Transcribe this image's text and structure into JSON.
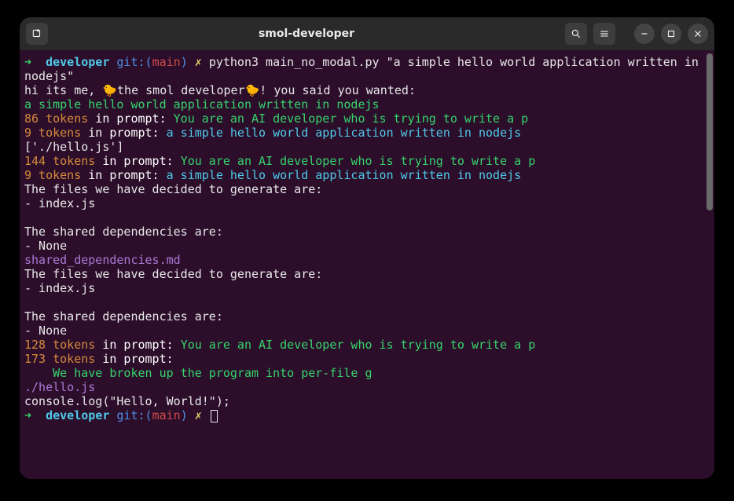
{
  "title": "smol-developer",
  "prompt": {
    "arrow": "➜",
    "dir": "developer",
    "git": "git:(",
    "branch": "main",
    "gitclose": ")",
    "dirty": "✗"
  },
  "command": "python3 main_no_modal.py \"a simple hello world application written in nodejs\"",
  "lines": {
    "hi_prefix": "hi its me, ",
    "chick": "🐤",
    "hi_mid": "the smol developer",
    "hi_suffix": "! you said you wanted:",
    "want": "a simple hello world application written in nodejs",
    "t86": "86 tokens",
    "t9": "9 tokens",
    "t144": "144 tokens",
    "t128": "128 tokens",
    "t173": "173 tokens",
    "in_prompt": " in prompt: ",
    "ai_dev": "You are an AI developer who is trying to write a p",
    "echo_want": "a simple hello world application written in nodejs",
    "hello_list": "['./hello.js']",
    "files_decided": "The files we have decided to generate are:",
    "index": "- index.js",
    "blank": "",
    "shared_deps_are": "The shared dependencies are:",
    "none": "- None",
    "shared_md": "shared_dependencies.md",
    "broken_indent": "    ",
    "broken": "We have broken up the program into per-file g",
    "hello_js": "./hello.js",
    "console": "console.log(\"Hello, World!\");"
  }
}
